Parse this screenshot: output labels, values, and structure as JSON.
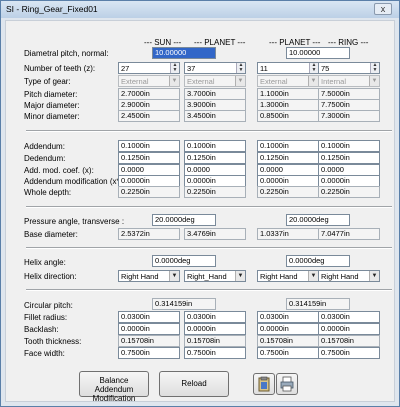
{
  "window": {
    "title": "SI - Ring_Gear_Fixed01",
    "close_label": "x"
  },
  "columns": {
    "sun": "--- SUN ---",
    "planet1": "--- PLANET ---",
    "planet2": "--- PLANET ---",
    "ring": "--- RING ---"
  },
  "labels": {
    "diametral_pitch": "Diametral pitch, normal:",
    "num_teeth": "Number of teeth (z):",
    "type_of_gear": "Type of gear:",
    "pitch_diameter": "Pitch diameter:",
    "major_diameter": "Major diameter:",
    "minor_diameter": "Minor diameter:",
    "addendum": "Addendum:",
    "dedendum": "Dedendum:",
    "add_mod_coef": "Add. mod. coef. (x):",
    "addendum_mod": "Addendum modification (x*m)",
    "whole_depth": "Whole depth:",
    "pressure_angle": "Pressure angle, transverse :",
    "base_diameter": "Base diameter:",
    "helix_angle": "Helix angle:",
    "helix_direction": "Helix direction:",
    "circular_pitch": "Circular pitch:",
    "fillet_radius": "Fillet radius:",
    "backlash": "Backlash:",
    "tooth_thickness": "Tooth thickness:",
    "face_width": "Face width:"
  },
  "values": {
    "diametral_pitch_1": "10.00000",
    "diametral_pitch_2": "10.00000",
    "teeth": [
      "27",
      "37",
      "11",
      "75"
    ],
    "gear_type": [
      "External",
      "External",
      "External",
      "Internal"
    ],
    "pitch_diameter": [
      "2.7000in",
      "3.7000in",
      "1.1000in",
      "7.5000in"
    ],
    "major_diameter": [
      "2.9000in",
      "3.9000in",
      "1.3000in",
      "7.7500in"
    ],
    "minor_diameter": [
      "2.4500in",
      "3.4500in",
      "0.8500in",
      "7.3000in"
    ],
    "addendum": [
      "0.1000in",
      "0.1000in",
      "0.1000in",
      "0.1000in"
    ],
    "dedendum": [
      "0.1250in",
      "0.1250in",
      "0.1250in",
      "0.1250in"
    ],
    "add_mod_coef": [
      "0.0000",
      "0.0000",
      "0.0000",
      "0.0000"
    ],
    "addendum_mod": [
      "0.0000in",
      "0.0000in",
      "0.0000in",
      "0.0000in"
    ],
    "whole_depth": [
      "0.2250in",
      "0.2250in",
      "0.2250in",
      "0.2250in"
    ],
    "pressure_angle_1": "20.0000deg",
    "pressure_angle_2": "20.0000deg",
    "base_diameter": [
      "2.5372in",
      "3.4769in",
      "1.0337in",
      "7.0477in"
    ],
    "helix_angle_1": "0.0000deg",
    "helix_angle_2": "0.0000deg",
    "helix_direction": [
      "Right Hand",
      "Right_Hand",
      "Right Hand",
      "Right Hand"
    ],
    "circular_pitch_1": "0.314159in",
    "circular_pitch_2": "0.314159in",
    "fillet_radius": [
      "0.0300in",
      "0.0300in",
      "0.0300in",
      "0.0300in"
    ],
    "backlash": [
      "0.0000in",
      "0.0000in",
      "0.0000in",
      "0.0000in"
    ],
    "tooth_thickness": [
      "0.15708in",
      "0.15708in",
      "0.15708in",
      "0.15708in"
    ],
    "face_width": [
      "0.7500in",
      "0.7500in",
      "0.7500in",
      "0.7500in"
    ]
  },
  "buttons": {
    "balance_line1": "Balance Addendum",
    "balance_line2": "Modification",
    "reload": "Reload"
  },
  "icons": {
    "clipboard": "clipboard-icon",
    "print": "print-icon"
  }
}
